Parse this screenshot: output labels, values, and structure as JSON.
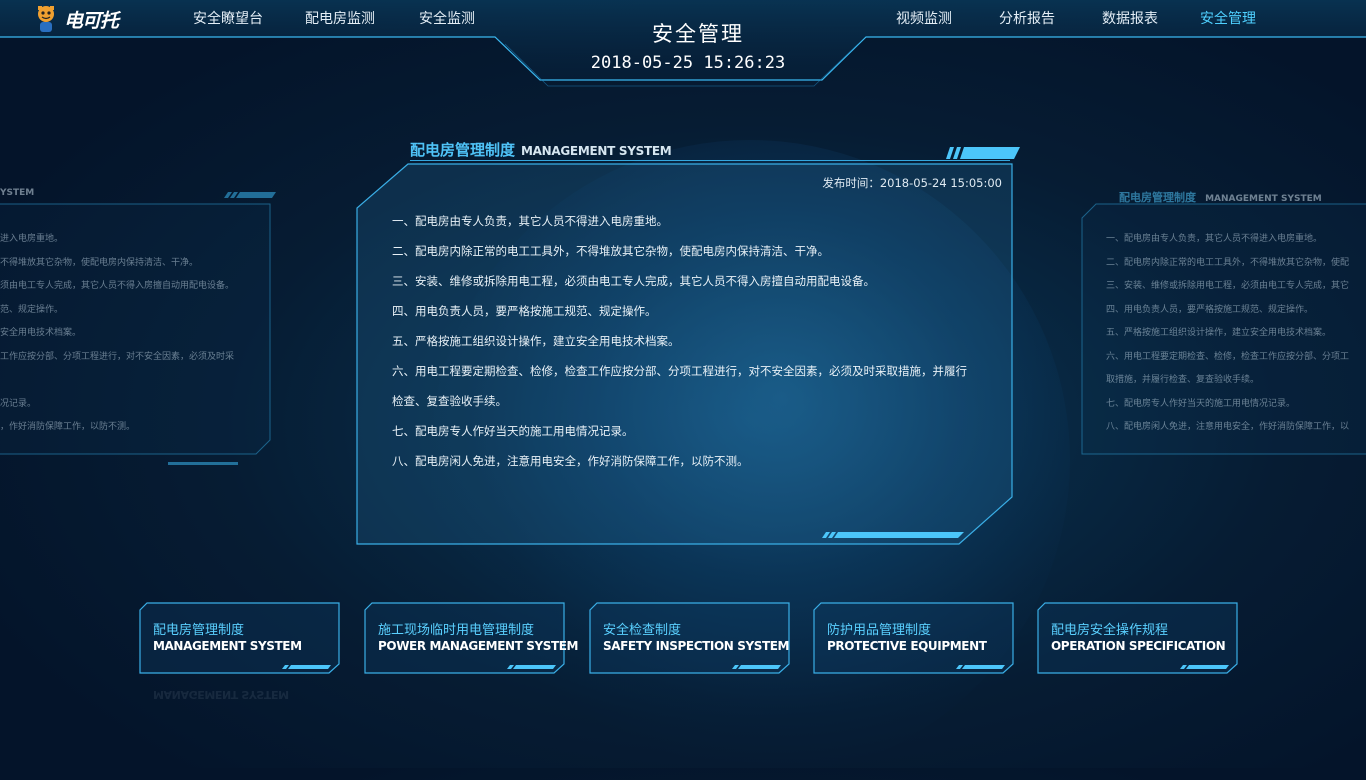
{
  "header": {
    "logo_text": "电可托",
    "title": "安全管理",
    "datetime": "2018-05-25  15:26:23",
    "nav_left": [
      "安全瞭望台",
      "配电房监测",
      "安全监测"
    ],
    "nav_right": [
      "视频监测",
      "分析报告",
      "数据报表",
      "安全管理"
    ],
    "active": "安全管理"
  },
  "main_panel": {
    "title_cn": "配电房管理制度",
    "title_en": "MANAGEMENT SYSTEM",
    "publish_label": "发布时间：2018-05-24  15:05:00",
    "rules": [
      "一、配电房由专人负责，其它人员不得进入电房重地。",
      "二、配电房内除正常的电工工具外，不得堆放其它杂物，使配电房内保持清洁、干净。",
      "三、安装、维修或拆除用电工程，必须由电工专人完成，其它人员不得入房擅自动用配电设备。",
      "四、用电负责人员，要严格按施工规范、规定操作。",
      "五、严格按施工组织设计操作，建立安全用电技术档案。",
      "六、用电工程要定期检查、检修，检查工作应按分部、分项工程进行，对不安全因素，必须及时采取措施，并履行",
      "检查、复查验收手续。",
      "七、配电房专人作好当天的施工用电情况记录。",
      "八、配电房闲人免进，注意用电安全，作好消防保障工作，以防不测。"
    ]
  },
  "left_panel": {
    "title_en": "YSTEM",
    "rules": [
      "进入电房重地。",
      "不得堆放其它杂物，使配电房内保持清洁、干净。",
      "须由电工专人完成，其它人员不得入房擅自动用配电设备。",
      "范、规定操作。",
      "安全用电技术档案。",
      "工作应按分部、分项工程进行，对不安全因素，必须及时采",
      "",
      "况记录。",
      "，作好消防保障工作，以防不测。"
    ]
  },
  "right_panel": {
    "title_cn": "配电房管理制度",
    "title_en": "MANAGEMENT SYSTEM",
    "rules": [
      "一、配电房由专人负责，其它人员不得进入电房重地。",
      "二、配电房内除正常的电工工具外，不得堆放其它杂物，使配",
      "三、安装、维修或拆除用电工程，必须由电工专人完成，其它",
      "四、用电负责人员，要严格按施工规范、规定操作。",
      "五、严格按施工组织设计操作，建立安全用电技术档案。",
      "六、用电工程要定期检查、检修，检查工作应按分部、分项工",
      "取措施，并履行检查、复查验收手续。",
      "七、配电房专人作好当天的施工用电情况记录。",
      "八、配电房闲人免进，注意用电安全，作好消防保障工作，以"
    ]
  },
  "cards": [
    {
      "cn": "配电房管理制度",
      "en": "MANAGEMENT SYSTEM"
    },
    {
      "cn": "施工现场临时用电管理制度",
      "en": "POWER MANAGEMENT SYSTEM"
    },
    {
      "cn": "安全检查制度",
      "en": "SAFETY INSPECTION SYSTEM"
    },
    {
      "cn": "防护用品管理制度",
      "en": "PROTECTIVE EQUIPMENT"
    },
    {
      "cn": "配电房安全操作规程",
      "en": "OPERATION SPECIFICATION"
    }
  ],
  "colors": {
    "accent": "#4fc3f7",
    "active_nav": "#4fd0ff",
    "frame": "#2fa8e0",
    "background": "#061c33"
  }
}
